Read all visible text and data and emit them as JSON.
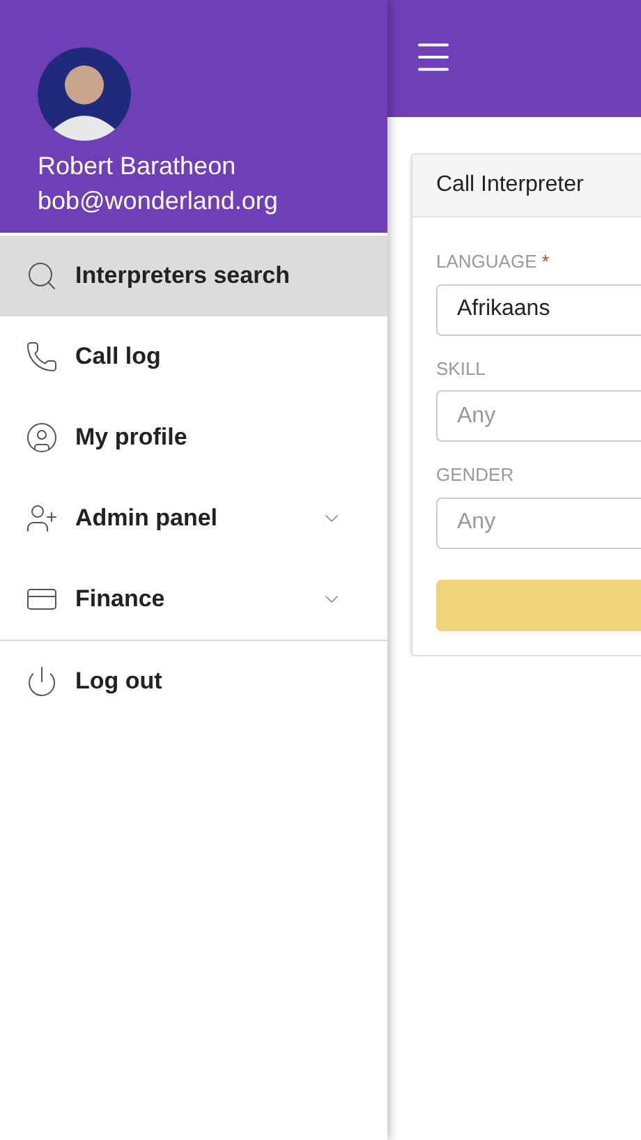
{
  "user": {
    "name": "Robert Baratheon",
    "email": "bob@wonderland.org"
  },
  "menu": [
    {
      "label": "Interpreters search",
      "kind": "search",
      "selected": true,
      "expandable": false
    },
    {
      "label": "Call log",
      "kind": "phone",
      "selected": false,
      "expandable": false
    },
    {
      "label": "My profile",
      "kind": "profile",
      "selected": false,
      "expandable": false
    },
    {
      "label": "Admin panel",
      "kind": "admin",
      "selected": false,
      "expandable": true
    },
    {
      "label": "Finance",
      "kind": "finance",
      "selected": false,
      "expandable": true
    }
  ],
  "footer_menu": [
    {
      "label": "Log out",
      "kind": "logout",
      "selected": false,
      "expandable": false
    }
  ],
  "card": {
    "title": "Call Interpreter",
    "fields": [
      {
        "label": "LANGUAGE",
        "required_mark": "*",
        "value": "Afrikaans"
      },
      {
        "label": "SKILL",
        "placeholder": "Any"
      },
      {
        "label": "GENDER",
        "placeholder": "Any"
      }
    ]
  }
}
